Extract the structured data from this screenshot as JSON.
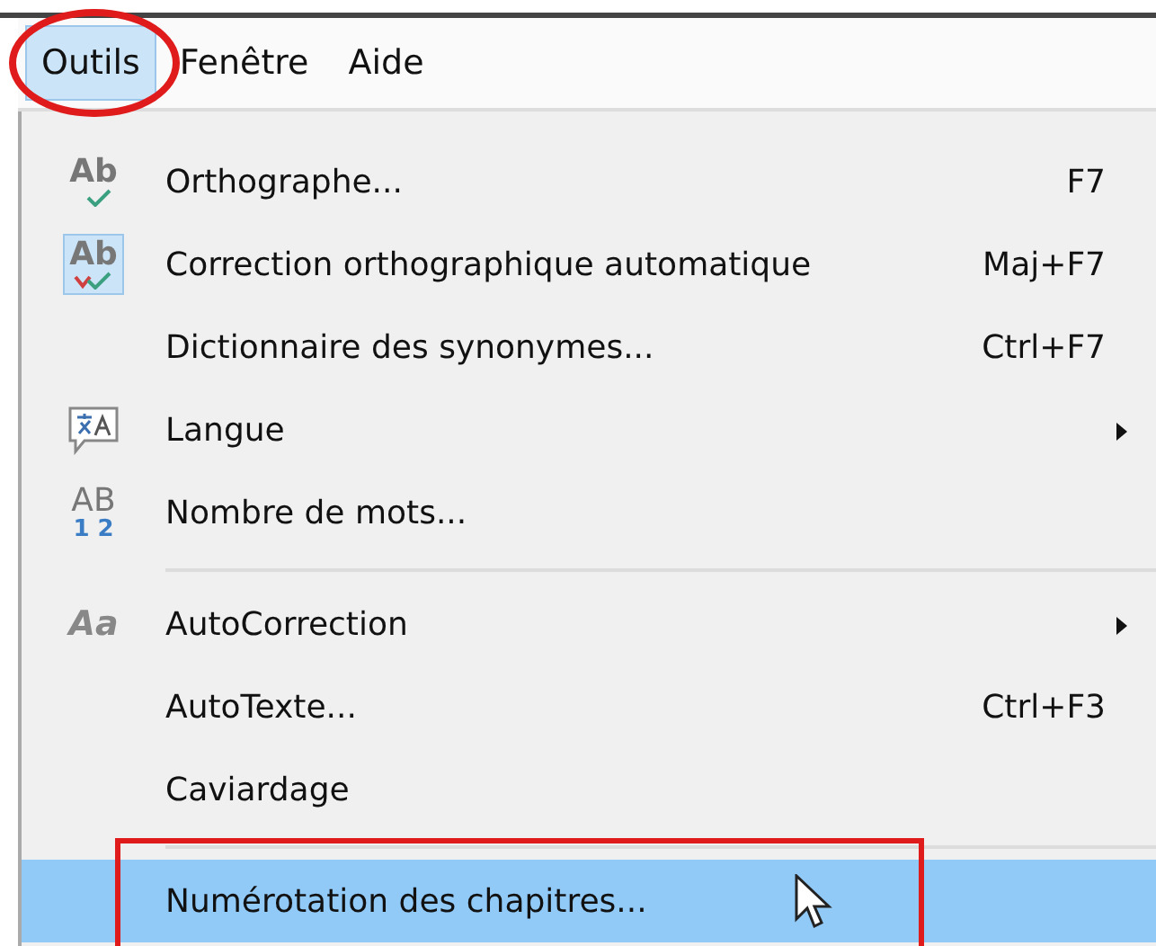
{
  "menubar": [
    {
      "label": "Outils",
      "selected": true,
      "circled": true
    },
    {
      "label": "Fenêtre",
      "selected": false,
      "circled": false
    },
    {
      "label": "Aide",
      "selected": false,
      "circled": false
    }
  ],
  "menu": [
    {
      "kind": "item",
      "label": "Orthographe...",
      "shortcut": "F7",
      "icon": {
        "kind": "spell",
        "glyph": "Ab"
      },
      "checked": false,
      "submenu": false,
      "selected": false,
      "boxed": false
    },
    {
      "kind": "item",
      "label": "Correction orthographique automatique",
      "shortcut": "Maj+F7",
      "icon": {
        "kind": "autospell",
        "glyph": "Ab"
      },
      "checked": true,
      "submenu": false,
      "selected": false,
      "boxed": false
    },
    {
      "kind": "item",
      "label": "Dictionnaire des synonymes...",
      "shortcut": "Ctrl+F7",
      "checked": false,
      "submenu": false,
      "selected": false,
      "boxed": false
    },
    {
      "kind": "item",
      "label": "Langue",
      "icon": {
        "kind": "language"
      },
      "checked": false,
      "submenu": true,
      "selected": false,
      "boxed": false
    },
    {
      "kind": "item",
      "label": "Nombre de mots...",
      "icon": {
        "kind": "wordcount",
        "glyph": "AB",
        "glyph2": "1 2"
      },
      "checked": false,
      "submenu": false,
      "selected": false,
      "boxed": false
    },
    {
      "kind": "separator"
    },
    {
      "kind": "item",
      "label": "AutoCorrection",
      "icon": {
        "kind": "text",
        "glyph": "Aa"
      },
      "checked": false,
      "submenu": true,
      "selected": false,
      "boxed": false
    },
    {
      "kind": "item",
      "label": "AutoTexte...",
      "shortcut": "Ctrl+F3",
      "checked": false,
      "submenu": false,
      "selected": false,
      "boxed": false
    },
    {
      "kind": "item",
      "label": "Caviardage",
      "checked": false,
      "submenu": false,
      "selected": false,
      "boxed": false
    },
    {
      "kind": "separator"
    },
    {
      "kind": "item",
      "label": "Numérotation des chapitres...",
      "checked": false,
      "submenu": false,
      "selected": true,
      "boxed": true
    }
  ]
}
